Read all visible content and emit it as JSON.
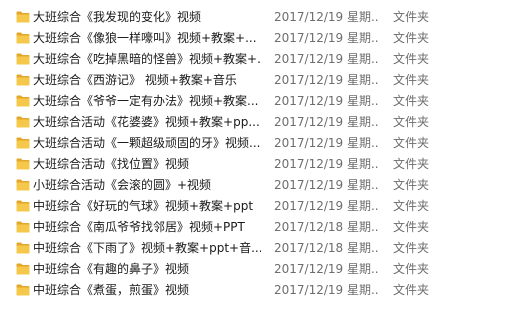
{
  "icon": "folder-icon",
  "colors": {
    "folder_front": "#f5c84c",
    "folder_back": "#e3a82b",
    "secondary_text": "#6d6d6d"
  },
  "rows": [
    {
      "name": "大班综合《我发现的变化》视频",
      "date": "2017/12/19 星期...",
      "type": "文件夹"
    },
    {
      "name": "大班综合《像狼一样嚎叫》视频+教案+...",
      "date": "2017/12/19 星期...",
      "type": "文件夹"
    },
    {
      "name": "大班综合《吃掉黑暗的怪兽》视频+教案+...",
      "date": "2017/12/19 星期...",
      "type": "文件夹"
    },
    {
      "name": "大班综合《西游记》 视频+教案+音乐",
      "date": "2017/12/19 星期...",
      "type": "文件夹"
    },
    {
      "name": "大班综合《爷爷一定有办法》视频+教案...",
      "date": "2017/12/19 星期...",
      "type": "文件夹"
    },
    {
      "name": "大班综合活动《花婆婆》视频+教案+pp...",
      "date": "2017/12/19 星期...",
      "type": "文件夹"
    },
    {
      "name": "大班综合活动《一颗超级顽固的牙》视频...",
      "date": "2017/12/19 星期...",
      "type": "文件夹"
    },
    {
      "name": "大班综合活动《找位置》视频",
      "date": "2017/12/19 星期...",
      "type": "文件夹"
    },
    {
      "name": "小班综合活动《会滚的圆》+视频",
      "date": "2017/12/19 星期...",
      "type": "文件夹"
    },
    {
      "name": "中班综合《好玩的气球》视频+教案+ppt",
      "date": "2017/12/19 星期...",
      "type": "文件夹"
    },
    {
      "name": "中班综合《南瓜爷爷找邻居》视频+PPT",
      "date": "2017/12/18 星期...",
      "type": "文件夹"
    },
    {
      "name": "中班综合《下雨了》视频+教案+ppt+音...",
      "date": "2017/12/18 星期...",
      "type": "文件夹"
    },
    {
      "name": "中班综合《有趣的鼻子》视频",
      "date": "2017/12/19 星期...",
      "type": "文件夹"
    },
    {
      "name": "中班综合《煮蛋，煎蛋》视频",
      "date": "2017/12/19 星期...",
      "type": "文件夹"
    }
  ]
}
